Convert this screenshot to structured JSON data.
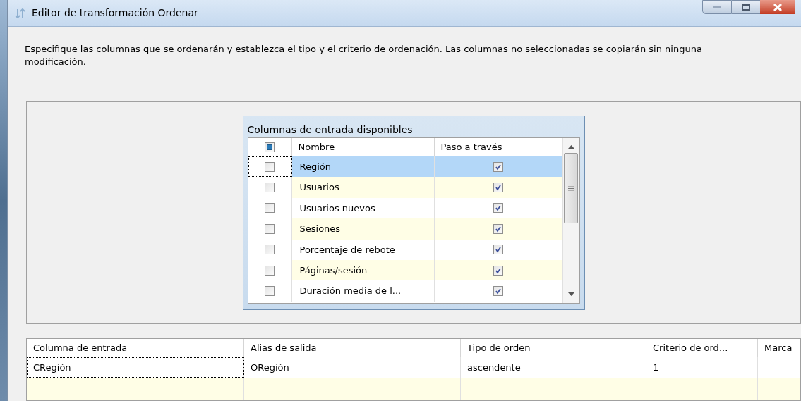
{
  "window": {
    "title": "Editor de transformación Ordenar"
  },
  "description": "Especifique las columnas que se ordenarán y establezca el tipo y el criterio de ordenación. Las columnas no seleccionadas se copiarán sin ninguna modificación.",
  "input_columns": {
    "title": "Columnas de entrada disponibles",
    "header_indeterminate": true,
    "columns": [
      "Nombre",
      "Paso a través"
    ],
    "rows": [
      {
        "name": "Región",
        "checked": false,
        "pass_through": true,
        "selected": true
      },
      {
        "name": "Usuarios",
        "checked": false,
        "pass_through": true,
        "selected": false
      },
      {
        "name": "Usuarios nuevos",
        "checked": false,
        "pass_through": true,
        "selected": false
      },
      {
        "name": "Sesiones",
        "checked": false,
        "pass_through": true,
        "selected": false
      },
      {
        "name": "Porcentaje de rebote",
        "checked": false,
        "pass_through": true,
        "selected": false
      },
      {
        "name": "Páginas/sesión",
        "checked": false,
        "pass_through": true,
        "selected": false
      },
      {
        "name": "Duración media de l...",
        "checked": false,
        "pass_through": true,
        "selected": false
      }
    ]
  },
  "sort_grid": {
    "columns": [
      "Columna de entrada",
      "Alias de salida",
      "Tipo de orden",
      "Criterio de ord...",
      "Marca"
    ],
    "rows": [
      [
        "CRegión",
        "ORegión",
        "ascendente",
        "1"
      ]
    ]
  }
}
